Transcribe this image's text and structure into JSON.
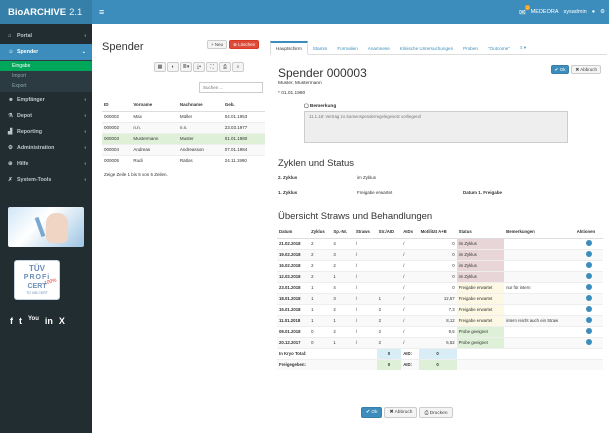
{
  "app": {
    "brand": "BioARCHIVE",
    "version": "2.1",
    "notifications": "2",
    "org": "MEDEORA",
    "user": "sysadmin"
  },
  "sidebar": {
    "items": [
      {
        "label": "Portal",
        "icon": "home-icon"
      },
      {
        "label": "Spender",
        "icon": "user-icon"
      },
      {
        "label": "Empfänger",
        "icon": "users-icon"
      },
      {
        "label": "Depot",
        "icon": "flask-icon"
      },
      {
        "label": "Reporting",
        "icon": "chart-icon"
      },
      {
        "label": "Administration",
        "icon": "gear-icon"
      },
      {
        "label": "Hilfe",
        "icon": "help-icon"
      },
      {
        "label": "System-Tools",
        "icon": "wrench-icon"
      }
    ],
    "subitems": [
      "Eingabe",
      "Import",
      "Export"
    ],
    "cert": {
      "line1": "TÜV",
      "line2": "PROFi",
      "line3": "CERT",
      "line4": "TÜ VIB CERT",
      "star": "100%"
    },
    "social": [
      "f",
      "t",
      "You",
      "in",
      "X"
    ]
  },
  "left": {
    "title": "Spender",
    "new_label": "+ Neu",
    "delete_label": "⊗ Löschen",
    "search_placeholder": "Suchen ...",
    "columns": [
      "ID",
      "Vorname",
      "Nachname",
      "Geb."
    ],
    "rows": [
      [
        "000002",
        "Max",
        "Müller",
        "04.01.1953"
      ],
      [
        "000002",
        "n.n.",
        "n.n.",
        "23.03.1977"
      ],
      [
        "000003",
        "Mustermann",
        "Muster",
        "01.01.1980"
      ],
      [
        "000004",
        "Andreas",
        "Andreasson",
        "07.01.1984"
      ],
      [
        "000005",
        "Rudi",
        "Ratlos",
        "24.11.1990"
      ]
    ],
    "footer": "Zeige Zeile 1 bis 5 von 5 Zeilen."
  },
  "right": {
    "tabs": [
      "Hauptschirm",
      "Stamm",
      "Formalien",
      "Anamnese",
      "Klinische Untersuchungen",
      "Proben",
      "\"Outcome\"",
      "≡ ▾"
    ],
    "title": "Spender 000003",
    "ok_label": "✔ Ok",
    "cancel_label": "✖ Abbruch",
    "name": "Muster, Mustermann",
    "birth": "* 01.01.1980",
    "remark_label": "▢ Bemerkung",
    "remark_text": "11.1.18: Vertrag zu Samenspenderregelegesetz vorliegend",
    "cycles_title": "Zyklen und Status",
    "cycle_row1": [
      "2. Zyklus",
      "im Zyklus",
      ""
    ],
    "cycle_row2": [
      "1. Zyklus",
      "Freigabe erwartet",
      "Datum 1. Freigabe"
    ],
    "straws_title": "Übersicht Straws und Behandlungen",
    "columns": [
      "Datum",
      "Zyklus",
      "Sp.-Nr.",
      "Straws",
      "Str./AID",
      "AIDs",
      "Motilität A+B",
      "Status",
      "Bemerkungen",
      "Aktionen"
    ],
    "rows": [
      [
        "21.02.2018",
        "2",
        "4",
        "/",
        "",
        "/",
        "0",
        "im Zyklus",
        ""
      ],
      [
        "19.02.2018",
        "2",
        "3",
        "/",
        "",
        "/",
        "0",
        "im Zyklus",
        ""
      ],
      [
        "15.02.2018",
        "2",
        "2",
        "/",
        "",
        "/",
        "0",
        "im Zyklus",
        ""
      ],
      [
        "12.02.2018",
        "2",
        "1",
        "/",
        "",
        "/",
        "0",
        "im Zyklus",
        ""
      ],
      [
        "23.01.2018",
        "1",
        "4",
        "/",
        "",
        "/",
        "0",
        "Freigabe erwartet",
        "nur für intern"
      ],
      [
        "18.01.2018",
        "1",
        "3",
        "/",
        "1",
        "/",
        "12,57",
        "Freigabe erwartet",
        ""
      ],
      [
        "15.01.2018",
        "1",
        "2",
        "/",
        "2",
        "/",
        "7,3",
        "Freigabe erwartet",
        ""
      ],
      [
        "11.01.2018",
        "1",
        "1",
        "/",
        "2",
        "/",
        "8,12",
        "Freigabe erwartet",
        "intern reicht auch ein Straw"
      ],
      [
        "08.01.2018",
        "0",
        "2",
        "/",
        "2",
        "/",
        "9,5",
        "Probe geeignet",
        ""
      ],
      [
        "20.12.2017",
        "0",
        "1",
        "/",
        "2",
        "/",
        "6,62",
        "Probe geeignet",
        ""
      ]
    ],
    "total_kryo": [
      "In Kryo Total:",
      "0",
      "AID:",
      "0"
    ],
    "total_frei": [
      "Freigegeben:",
      "0",
      "AID:",
      "0"
    ],
    "bottom_ok": "✔ Ok",
    "bottom_cancel": "✖ Abbruch",
    "bottom_print": "⎙ Drucken"
  }
}
